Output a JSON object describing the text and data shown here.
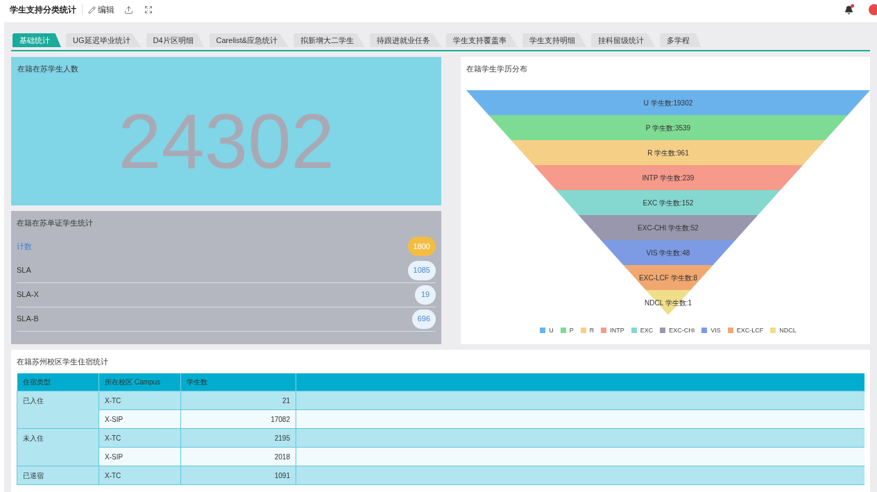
{
  "header": {
    "title": "学生支持分类统计",
    "edit_label": "编辑",
    "notification_dot": true
  },
  "tabs": [
    {
      "label": "基础统计",
      "selected": true
    },
    {
      "label": "UG延迟毕业统计",
      "selected": false
    },
    {
      "label": "D4片区明细",
      "selected": false
    },
    {
      "label": "Carelist&应急统计",
      "selected": false
    },
    {
      "label": "拟新增大二学生",
      "selected": false
    },
    {
      "label": "待跟进就业任务",
      "selected": false
    },
    {
      "label": "学生支持覆盖率",
      "selected": false
    },
    {
      "label": "学生支持明细",
      "selected": false
    },
    {
      "label": "挂科留级统计",
      "selected": false
    },
    {
      "label": "多学程",
      "selected": false
    }
  ],
  "enrolled_panel": {
    "title": "在籍在苏学生人数",
    "value": "24302"
  },
  "single_cert_panel": {
    "title": "在籍在苏单证学生统计",
    "rows": [
      {
        "kind": "total",
        "label": "计数",
        "count": "1800"
      },
      {
        "kind": "item",
        "label": "SLA",
        "count": "1085"
      },
      {
        "kind": "item",
        "label": "SLA-X",
        "count": "19"
      },
      {
        "kind": "item",
        "label": "SLA-B",
        "count": "696"
      }
    ]
  },
  "degree_panel": {
    "title": "在籍学生学历分布",
    "segments": [
      {
        "label": "U 学生数:19302",
        "color": "#6ab2ec"
      },
      {
        "label": "P 学生数:3539",
        "color": "#7edb93"
      },
      {
        "label": "R 学生数:961",
        "color": "#f6cf87"
      },
      {
        "label": "INTP 学生数:239",
        "color": "#f69a8b"
      },
      {
        "label": "EXC 学生数:152",
        "color": "#84d8d0"
      },
      {
        "label": "EXC-CHI 学生数:52",
        "color": "#9897ae"
      },
      {
        "label": "VIS 学生数:48",
        "color": "#7c9be4"
      },
      {
        "label": "EXC-LCF 学生数:8",
        "color": "#f0a870"
      },
      {
        "label": "NDCL 学生数:1",
        "color": "#f0de8a"
      }
    ],
    "legend": [
      {
        "name": "U",
        "color": "#6ab2ec"
      },
      {
        "name": "P",
        "color": "#7edb93"
      },
      {
        "name": "R",
        "color": "#f6cf87"
      },
      {
        "name": "INTP",
        "color": "#f69a8b"
      },
      {
        "name": "EXC",
        "color": "#84d8d0"
      },
      {
        "name": "EXC-CHI",
        "color": "#9897ae"
      },
      {
        "name": "VIS",
        "color": "#7c9be4"
      },
      {
        "name": "EXC-LCF",
        "color": "#f0a870"
      },
      {
        "name": "NDCL",
        "color": "#f0de8a"
      }
    ]
  },
  "housing_panel": {
    "title": "在籍苏州校区学生住宿统计",
    "columns": [
      "住宿类型",
      "所在校区 Campus",
      "学生数"
    ],
    "groups": [
      {
        "type": "已入住",
        "rows": [
          {
            "campus": "X-TC",
            "count": "21"
          },
          {
            "campus": "X-SIP",
            "count": "17082"
          }
        ]
      },
      {
        "type": "未入住",
        "rows": [
          {
            "campus": "X-TC",
            "count": "2195"
          },
          {
            "campus": "X-SIP",
            "count": "2018"
          }
        ]
      },
      {
        "type": "已退宿",
        "rows": [
          {
            "campus": "X-TC",
            "count": "1091"
          }
        ]
      }
    ]
  }
}
